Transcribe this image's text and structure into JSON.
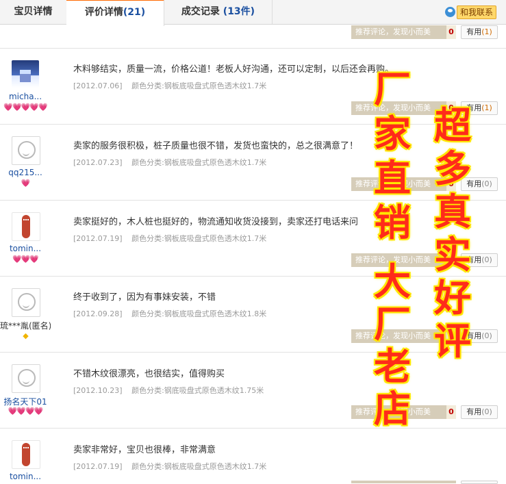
{
  "tabs": [
    {
      "label": "宝贝详情",
      "count": ""
    },
    {
      "label": "评价详情",
      "count": "(21)"
    },
    {
      "label": "成交记录 ",
      "count": "(13件)"
    }
  ],
  "contact_label": "和我联系",
  "top_strip": {
    "recommend_label": "推荐评论，发现小而美",
    "recommend_count": "0",
    "useful_label": "有用",
    "useful_count": "(1)"
  },
  "reviews": [
    {
      "nickname": "micha...",
      "hearts": "💗💗💗💗💗",
      "comment": "木料够结实，质量一流，价格公道！老板人好沟通，还可以定制，以后还会再购。",
      "date": "[2012.07.06]",
      "variant": "颜色分类:钢板底吸盘式原色透木纹1.7米",
      "recommend_label": "推荐评论，发现小而美",
      "recommend_count": "0",
      "useful_label": "有用",
      "useful_count": "(1)"
    },
    {
      "nickname": "qq215...",
      "hearts": "💗",
      "comment": "卖家的服务很积极，桩子质量也很不错，发货也蛮快的，总之很满意了！",
      "date": "[2012.07.23]",
      "variant": "颜色分类:钢板底吸盘式原色透木纹1.7米",
      "recommend_label": "推荐评论，发现小而美",
      "recommend_count": "0",
      "useful_label": "有用",
      "useful_count": "(0)"
    },
    {
      "nickname": "tomin...",
      "hearts": "💗💗💗",
      "comment": "卖家挺好的，木人桩也挺好的，物流通知收货没接到，卖家还打电话来问",
      "date": "[2012.07.19]",
      "variant": "颜色分类:钢板底吸盘式原色透木纹1.7米",
      "recommend_label": "推荐评论，发现小而美",
      "recommend_count": "0",
      "useful_label": "有用",
      "useful_count": "(0)"
    },
    {
      "nickname": "琉***胤(匿名)",
      "hearts": "◆",
      "comment": "终于收到了，因为有事妹安装，不错",
      "date": "[2012.09.28]",
      "variant": "颜色分类:钢板底吸盘式原色透木纹1.8米",
      "recommend_label": "推荐评论，发现小而美",
      "recommend_count": "0",
      "useful_label": "有用",
      "useful_count": "(0)"
    },
    {
      "nickname": "扬名天下01",
      "hearts": "💗💗💗💗",
      "comment": "不错木纹很漂亮，也很结实，值得购买",
      "date": "[2012.10.23]",
      "variant": "颜色分类:钢底吸盘式原色透木纹1.75米",
      "recommend_label": "推荐评论，发现小而美",
      "recommend_count": "0",
      "useful_label": "有用",
      "useful_count": "(0)"
    },
    {
      "nickname": "tomin...",
      "hearts": "",
      "comment": "卖家非常好，宝贝也很棒，非常满意",
      "date": "[2012.07.19]",
      "variant": "颜色分类:钢板底吸盘式原色透木纹1.7米",
      "recommend_label": "",
      "recommend_count": "",
      "useful_label": "",
      "useful_count": ""
    }
  ],
  "promo": {
    "left_top": [
      "厂",
      "家",
      "直",
      "销"
    ],
    "left_bottom": [
      "大",
      "厂",
      "老",
      "店"
    ],
    "right": [
      "超",
      "多",
      "真",
      "实",
      "好",
      "评"
    ]
  },
  "colors": {
    "accent_tab": "#ff6a00",
    "link_blue": "#1a4fa0",
    "promo_red": "#ff2b1a",
    "promo_yellow": "#ffe600",
    "recommend_bg": "#d6cdb9"
  }
}
